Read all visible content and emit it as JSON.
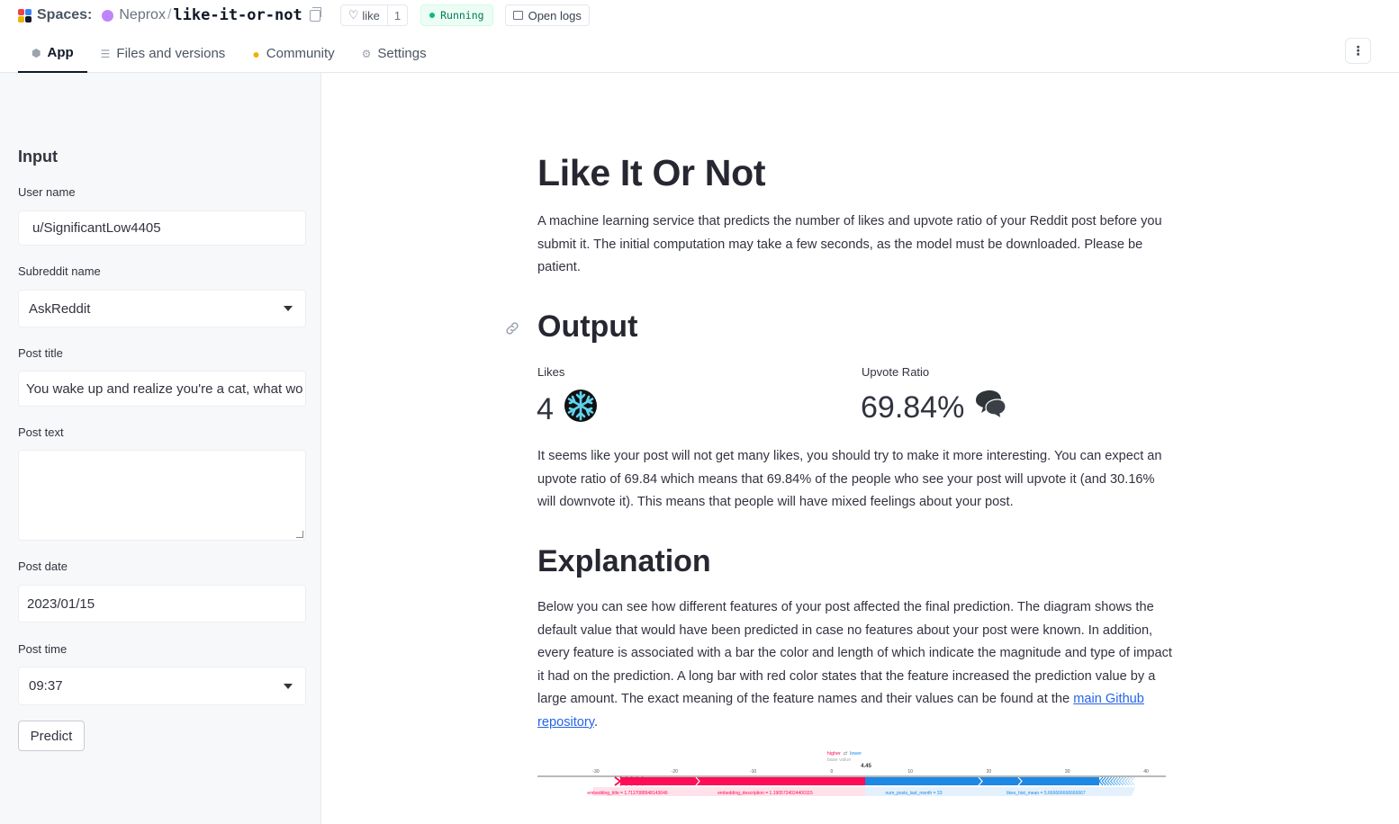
{
  "header": {
    "spaces_label": "Spaces:",
    "owner": "Neprox",
    "separator": "/",
    "repo": "like-it-or-not",
    "like_label": "like",
    "like_count": "1",
    "status": "Running",
    "open_logs": "Open logs",
    "tabs": [
      {
        "label": "App",
        "icon": "cube-icon",
        "active": true
      },
      {
        "label": "Files and versions",
        "icon": "files-icon",
        "active": false
      },
      {
        "label": "Community",
        "icon": "community-icon",
        "active": false
      },
      {
        "label": "Settings",
        "icon": "gear-icon",
        "active": false
      }
    ],
    "menu_icon": "⋮"
  },
  "sidebar": {
    "title": "Input",
    "user_name": {
      "label": "User name",
      "value": "u/SignificantLow4405"
    },
    "subreddit": {
      "label": "Subreddit name",
      "value": "AskReddit"
    },
    "post_title": {
      "label": "Post title",
      "value": "You wake up and realize you're a cat, what wo"
    },
    "post_text": {
      "label": "Post text",
      "value": ""
    },
    "post_date": {
      "label": "Post date",
      "value": "2023/01/15"
    },
    "post_time": {
      "label": "Post time",
      "value": "09:37"
    },
    "predict_label": "Predict"
  },
  "main": {
    "title": "Like It Or Not",
    "intro": "A machine learning service that predicts the number of likes and upvote ratio of your Reddit post before you submit it. The initial computation may take a few seconds, as the model must be downloaded. Please be patient.",
    "output_heading": "Output",
    "likes": {
      "label": "Likes",
      "value": "4",
      "emoji": "❄️"
    },
    "upvote": {
      "label": "Upvote Ratio",
      "value": "69.84%",
      "emoji": "🗨️"
    },
    "output_text": "It seems like your post will not get many likes, you should try to make it more interesting. You can expect an upvote ratio of 69.84 which means that 69.84% of the people who see your post will upvote it (and 30.16% will downvote it). This means that people will have mixed feelings about your post.",
    "explanation_heading": "Explanation",
    "explanation_text": "Below you can see how different features of your post affected the final prediction. The diagram shows the default value that would have been predicted in case no features about your post were known. In addition, every feature is associated with a bar the color and length of which indicate the magnitude and type of impact it had on the prediction. A long bar with red color states that the feature increased the prediction value by a large amount. The exact meaning of the feature names and their values can be found at the",
    "explanation_link": "main Github repository",
    "explanation_end": "."
  },
  "chart_data": {
    "type": "bar",
    "legend": {
      "higher": "higher",
      "arrows": "⇄",
      "lower": "lower",
      "base_value_label": "base value",
      "output_value": "4.45"
    },
    "x_ticks": [
      -30,
      -20,
      -10,
      0,
      10,
      20,
      30,
      40
    ],
    "features": [
      {
        "label": "embedding_title = 1.7117088948143646",
        "direction": "higher"
      },
      {
        "label": "embedding_description = 1.1905724024400115",
        "direction": "higher"
      },
      {
        "label": "num_posts_last_month = 33",
        "direction": "lower"
      },
      {
        "label": "likes_hist_mean = 5.666666666666667",
        "direction": "lower"
      }
    ],
    "colors": {
      "higher": "#ff0d57",
      "lower": "#1e88e5"
    }
  }
}
